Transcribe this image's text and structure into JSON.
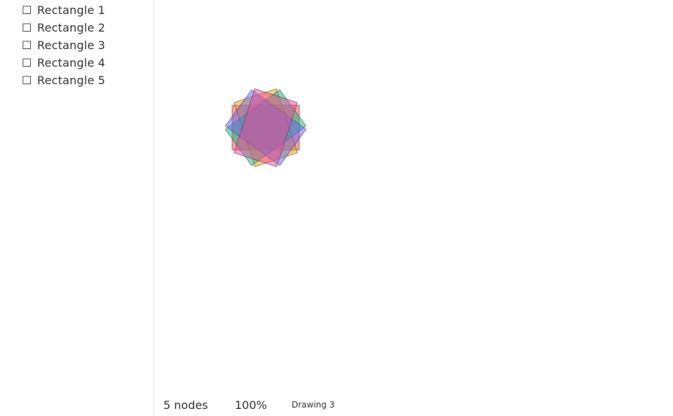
{
  "layers": [
    {
      "checkbox": "☐",
      "label": "Rectangle 1",
      "color": "#ef4444",
      "rotation": 0
    },
    {
      "checkbox": "☐",
      "label": "Rectangle 2",
      "color": "#f59e0b",
      "rotation": 72
    },
    {
      "checkbox": "☐",
      "label": "Rectangle 3",
      "color": "#10b981",
      "rotation": 144
    },
    {
      "checkbox": "☐",
      "label": "Rectangle 4",
      "color": "#6366f1",
      "rotation": 216
    },
    {
      "checkbox": "☐",
      "label": "Rectangle 5",
      "color": "#ec4899",
      "rotation": 288
    }
  ],
  "status": {
    "nodes": "5 nodes",
    "zoom": "100%",
    "document": "Drawing 3"
  }
}
